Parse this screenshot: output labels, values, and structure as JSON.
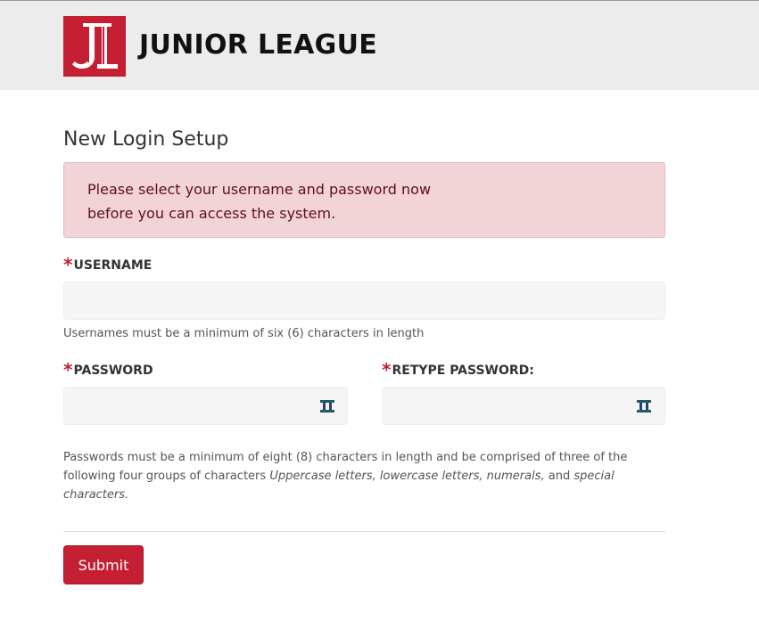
{
  "header": {
    "brand_name": "JUNIOR LEAGUE",
    "logo_icon": "junior-league-logo-icon",
    "logo_color": "#c41f33"
  },
  "page": {
    "title": "New Login Setup"
  },
  "alert": {
    "line1": "Please select your username and password now",
    "line2": "before you can access the system."
  },
  "form": {
    "required_marker": "*",
    "username": {
      "label": "USERNAME",
      "value": "",
      "help": "Usernames must be a minimum of six (6) characters in length"
    },
    "password": {
      "label": "PASSWORD",
      "value": "",
      "icon": "password-manager-icon"
    },
    "retype_password": {
      "label": "RETYPE PASSWORD:",
      "value": "",
      "icon": "password-manager-icon"
    },
    "password_help": {
      "part1": "Passwords must be a minimum of eight (8) characters in length and be comprised of three of the following four groups of characters ",
      "uppercase": "Uppercase letters,",
      "sep1": " ",
      "lowercase": "lowercase letters,",
      "sep2": " ",
      "numerals": "numerals,",
      "and": " and ",
      "special": "special characters."
    },
    "submit_label": "Submit"
  },
  "colors": {
    "accent": "#c41f33",
    "alert_bg": "#f2d3d7",
    "alert_text": "#5e0f18",
    "header_bg": "#ececec"
  }
}
